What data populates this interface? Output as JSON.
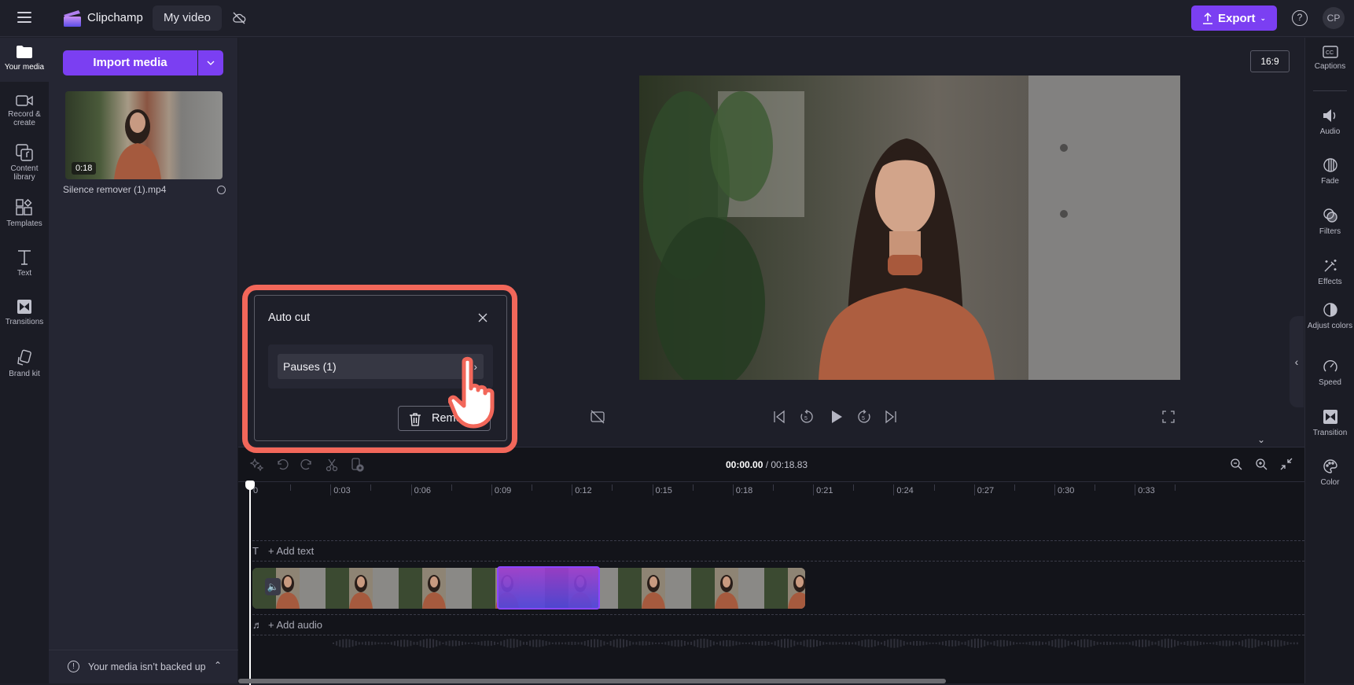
{
  "app": {
    "brand": "Clipchamp",
    "project_title": "My video",
    "export_label": "Export",
    "help_label": "?",
    "avatar_initials": "CP",
    "accent_color": "#7b3ff2",
    "highlight_color": "#f2675a"
  },
  "left_nav": {
    "items": [
      {
        "label": "Your media",
        "icon": "folder-icon",
        "active": true
      },
      {
        "label": "Record & create",
        "icon": "camera-icon"
      },
      {
        "label": "Content library",
        "icon": "content-library-icon"
      },
      {
        "label": "Templates",
        "icon": "templates-icon"
      },
      {
        "label": "Text",
        "icon": "text-icon"
      },
      {
        "label": "Transitions",
        "icon": "transitions-icon"
      },
      {
        "label": "Brand kit",
        "icon": "brand-kit-icon"
      }
    ]
  },
  "media_panel": {
    "import_label": "Import media",
    "items": [
      {
        "name": "Silence remover (1).mp4",
        "duration": "0:18"
      }
    ],
    "backup_notice": "Your media isn’t backed up"
  },
  "preview": {
    "aspect_ratio": "16:9",
    "controls": [
      "captions-off-icon",
      "skip-back-icon",
      "rewind-5-icon",
      "play-icon",
      "forward-5-icon",
      "skip-forward-icon",
      "fullscreen-icon"
    ],
    "rewind_seconds": "5",
    "forward_seconds": "5"
  },
  "right_nav": {
    "items": [
      {
        "label": "Captions",
        "icon": "captions-icon"
      },
      {
        "label": "Audio",
        "icon": "speaker-icon"
      },
      {
        "label": "Fade",
        "icon": "fade-icon"
      },
      {
        "label": "Filters",
        "icon": "filters-icon"
      },
      {
        "label": "Effects",
        "icon": "magic-wand-icon"
      },
      {
        "label": "Adjust colors",
        "icon": "adjust-colors-icon"
      },
      {
        "label": "Speed",
        "icon": "speedometer-icon"
      },
      {
        "label": "Transition",
        "icon": "transition-icon"
      },
      {
        "label": "Color",
        "icon": "palette-icon"
      }
    ]
  },
  "auto_cut": {
    "title": "Auto cut",
    "option_label": "Pauses (1)",
    "remove_label": "Remove"
  },
  "timeline": {
    "current_time": "00:00.00",
    "total_time": "/ 00:18.83",
    "ruler_labels": [
      "0",
      "0:03",
      "0:06",
      "0:09",
      "0:12",
      "0:15",
      "0:18",
      "0:21",
      "0:24",
      "0:27",
      "0:30",
      "0:33"
    ],
    "add_text_label": "+ Add text",
    "add_audio_label": "+ Add audio"
  }
}
